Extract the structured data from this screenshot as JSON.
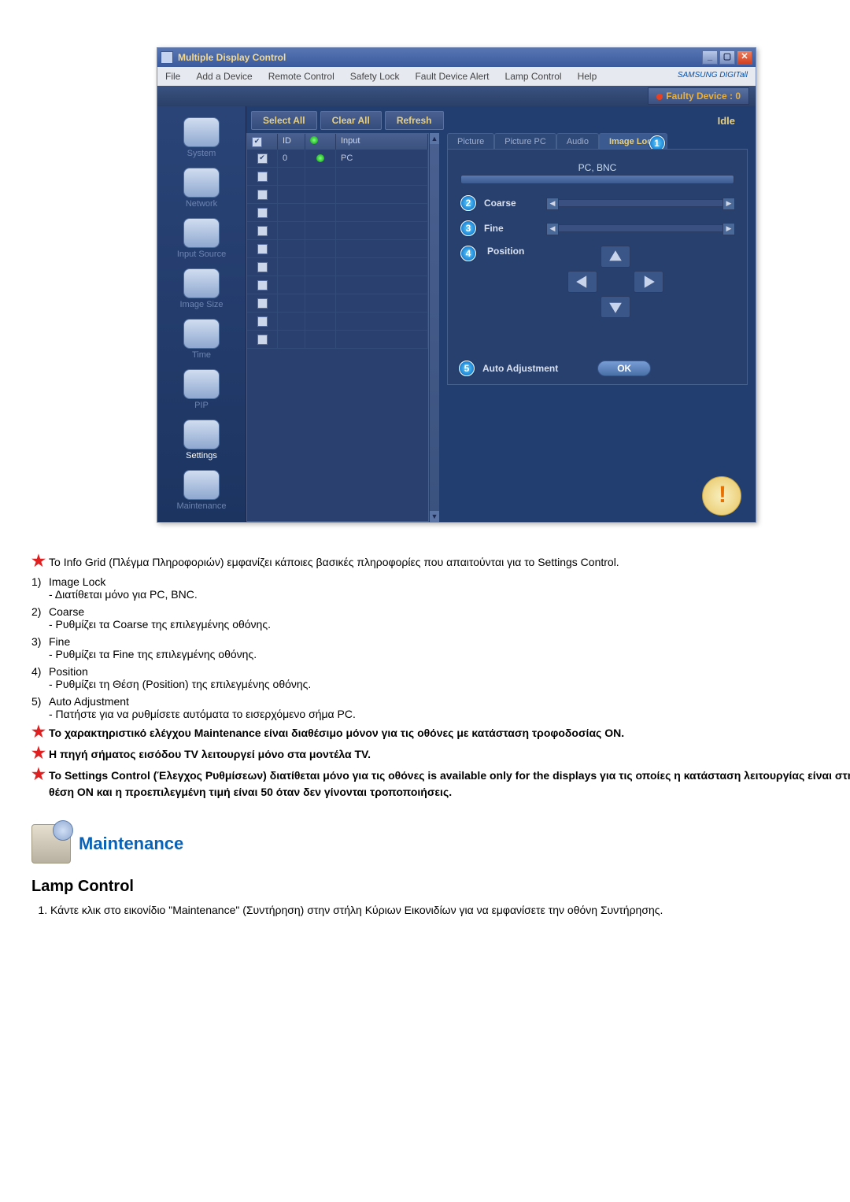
{
  "app": {
    "title": "Multiple Display Control"
  },
  "menu": [
    "File",
    "Add a Device",
    "Remote Control",
    "Safety Lock",
    "Fault Device Alert",
    "Lamp Control",
    "Help"
  ],
  "brand": "SAMSUNG DIGITall",
  "faulty": "Faulty Device : 0",
  "actions": {
    "selectAll": "Select All",
    "clearAll": "Clear All",
    "refresh": "Refresh",
    "idle": "Idle"
  },
  "nav": [
    "System",
    "Network",
    "Input Source",
    "Image Size",
    "Time",
    "PIP",
    "Settings",
    "Maintenance"
  ],
  "grid": {
    "headers": {
      "chk": "",
      "id": "ID",
      "led": "",
      "input": "Input"
    },
    "rows": [
      {
        "chk": true,
        "id": "0",
        "led": "g",
        "input": "PC"
      },
      {
        "chk": false,
        "id": "",
        "led": "",
        "input": ""
      },
      {
        "chk": false,
        "id": "",
        "led": "",
        "input": ""
      },
      {
        "chk": false,
        "id": "",
        "led": "",
        "input": ""
      },
      {
        "chk": false,
        "id": "",
        "led": "",
        "input": ""
      },
      {
        "chk": false,
        "id": "",
        "led": "",
        "input": ""
      },
      {
        "chk": false,
        "id": "",
        "led": "",
        "input": ""
      },
      {
        "chk": false,
        "id": "",
        "led": "",
        "input": ""
      },
      {
        "chk": false,
        "id": "",
        "led": "",
        "input": ""
      },
      {
        "chk": false,
        "id": "",
        "led": "",
        "input": ""
      },
      {
        "chk": false,
        "id": "",
        "led": "",
        "input": ""
      }
    ]
  },
  "tabs": [
    "Picture",
    "Picture PC",
    "Audio",
    "Image Lock"
  ],
  "panel": {
    "pcbnc": "PC, BNC",
    "coarse": "Coarse",
    "fine": "Fine",
    "position": "Position",
    "autoAdj": "Auto Adjustment",
    "ok": "OK"
  },
  "markers": {
    "1": "1",
    "2": "2",
    "3": "3",
    "4": "4",
    "5": "5"
  },
  "notes": {
    "line1": "Το Info Grid (Πλέγμα Πληροφοριών) εμφανίζει κάποιες βασικές πληροφορίες που απαιτούνται για το Settings Control.",
    "items": [
      {
        "n": "1)",
        "t": "Image Lock",
        "d": "- Διατίθεται μόνο για PC, BNC."
      },
      {
        "n": "2)",
        "t": "Coarse",
        "d": "- Ρυθμίζει τα Coarse της επιλεγμένης οθόνης."
      },
      {
        "n": "3)",
        "t": "Fine",
        "d": "- Ρυθμίζει τα Fine της επιλεγμένης οθόνης."
      },
      {
        "n": "4)",
        "t": "Position",
        "d": "- Ρυθμίζει τη Θέση (Position) της επιλεγμένης οθόνης."
      },
      {
        "n": "5)",
        "t": "Auto Adjustment",
        "d": "- Πατήστε για να ρυθμίσετε αυτόματα το εισερχόμενο σήμα PC."
      }
    ],
    "bold1": "Το χαρακτηριστικό ελέγχου Maintenance είναι διαθέσιμο μόνον για τις οθόνες με κατάσταση τροφοδοσίας ON.",
    "bold2": "Η πηγή σήματος εισόδου TV λειτουργεί μόνο στα μοντέλα TV.",
    "bold3": "Το Settings Control (Έλεγχος Ρυθμίσεων) διατίθεται μόνο για τις οθόνες is available only for the displays για τις οποίες η κατάσταση λειτουργίας είναι στη θέση ON και η προεπιλεγμένη τιμή είναι 50 όταν δεν γίνονται τροποποιήσεις."
  },
  "maintenance": {
    "title": "Maintenance"
  },
  "lamp": {
    "title": "Lamp Control",
    "step1": "Κάντε κλικ στο εικονίδιο \"Maintenance\" (Συντήρηση) στην στήλη Κύριων Εικονιδίων για να εμφανίσετε την οθόνη Συντήρησης."
  }
}
